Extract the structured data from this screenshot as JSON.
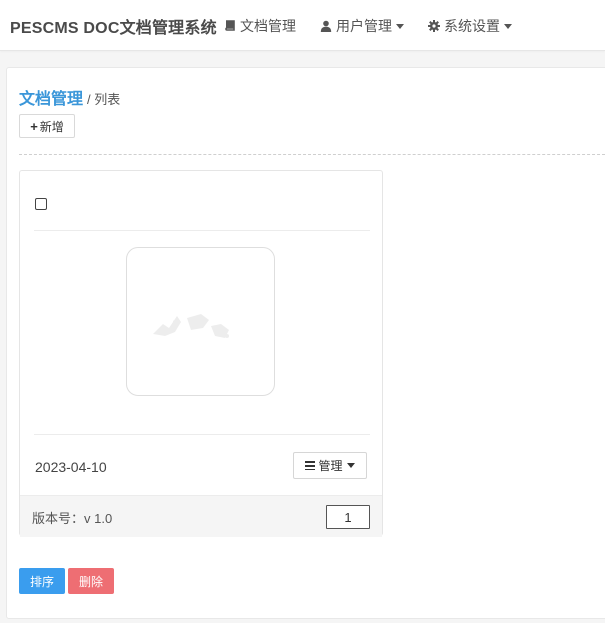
{
  "navbar": {
    "brand": "PESCMS DOC文档管理系统",
    "items": [
      {
        "label": "文档管理",
        "icon": "book-icon",
        "dropdown": false
      },
      {
        "label": "用户管理",
        "icon": "user-icon",
        "dropdown": true
      },
      {
        "label": "系统设置",
        "icon": "gear-icon",
        "dropdown": true
      }
    ]
  },
  "breadcrumb": {
    "main": "文档管理",
    "sub": "/ 列表"
  },
  "toolbar": {
    "add_label": "新增",
    "add_icon": "plus-icon"
  },
  "card": {
    "date": "2023-04-10",
    "manage_label": "管理",
    "version_label": "版本号：v 1.0",
    "sort_value": "1"
  },
  "actions": {
    "sort_label": "排序",
    "delete_label": "删除"
  },
  "colors": {
    "brand_text": "#4a4a4a",
    "link_blue": "#3a96d9",
    "sort_button": "#3a9dee",
    "delete_button": "#ee6e73"
  }
}
